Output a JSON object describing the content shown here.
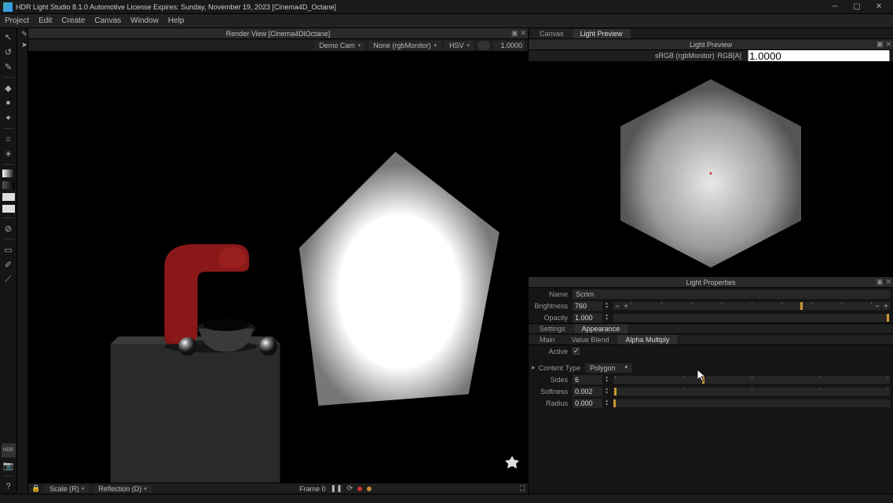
{
  "title": "HDR Light Studio 8.1.0   Automotive License Expires: Sunday, November 19, 2023   [Cinema4D_Octane]",
  "menus": [
    "Project",
    "Edit",
    "Create",
    "Canvas",
    "Window",
    "Help"
  ],
  "render_view": {
    "title": "Render View  [Cinema4DlOctane]",
    "camera": "Demo Cam",
    "monitor": "None (rgbMonitor)",
    "colorspace": "HSV",
    "exposure": "1.0000"
  },
  "footer": {
    "scale": "Scale (R)",
    "reflection": "Reflection (D)",
    "frame": "Frame 0"
  },
  "right_tabs": {
    "canvas": "Canvas",
    "preview": "Light Preview"
  },
  "preview": {
    "title": "Light Preview",
    "colorspace1": "sRGB (rgbMonitor)",
    "colorspace2": "RGB[A]",
    "exposure": "1.0000"
  },
  "props": {
    "title": "Light Properties",
    "name_label": "Name",
    "name_value": "Scrim",
    "brightness_label": "Brightness",
    "brightness_value": "760",
    "opacity_label": "Opacity",
    "opacity_value": "1.000",
    "tab_settings": "Settings",
    "tab_appearance": "Appearance",
    "sub_main": "Main",
    "sub_value_blend": "Value Blend",
    "sub_alpha_multiply": "Alpha Multiply",
    "active_label": "Active",
    "content_type_label": "Content Type",
    "content_type_value": "Polygon",
    "sides_label": "Sides",
    "sides_value": "6",
    "softness_label": "Softness",
    "softness_value": "0.002",
    "radius_label": "Radius",
    "radius_value": "0.000"
  },
  "tool_names": [
    "move",
    "rotate",
    "brush",
    "box",
    "sphere",
    "paint",
    "color",
    "star",
    "light1",
    "light2",
    "grad1",
    "grad2",
    "white1",
    "white2",
    "cancel",
    "crop",
    "edit",
    "pick",
    "hdr",
    "cam",
    "help"
  ],
  "icons": {
    "hdr": "HDR"
  }
}
